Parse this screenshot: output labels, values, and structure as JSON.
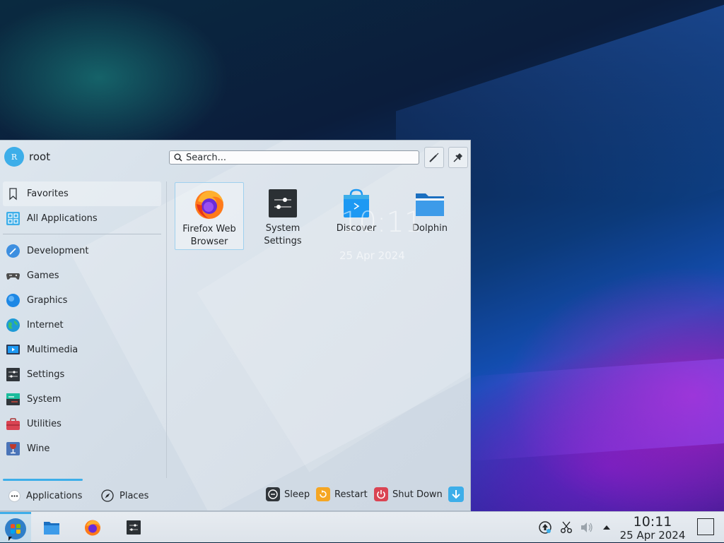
{
  "user": {
    "name": "root",
    "avatar_letter": "R"
  },
  "search": {
    "placeholder": "Search..."
  },
  "sidebar": {
    "top": [
      {
        "label": "Favorites",
        "icon": "bookmark-icon"
      },
      {
        "label": "All Applications",
        "icon": "grid-icon"
      }
    ],
    "categories": [
      {
        "label": "Development",
        "icon": "development-icon",
        "color": "#3d9be9"
      },
      {
        "label": "Games",
        "icon": "gamepad-icon",
        "color": "#4d4d4d"
      },
      {
        "label": "Graphics",
        "icon": "graphics-icon",
        "color": "#1e88e5"
      },
      {
        "label": "Internet",
        "icon": "globe-icon",
        "color": "#1e9ad6"
      },
      {
        "label": "Multimedia",
        "icon": "multimedia-icon",
        "color": "#2b3a55"
      },
      {
        "label": "Settings",
        "icon": "settings-icon",
        "color": "#31363b"
      },
      {
        "label": "System",
        "icon": "system-icon",
        "color": "#31363b"
      },
      {
        "label": "Utilities",
        "icon": "toolbox-icon",
        "color": "#da4453"
      },
      {
        "label": "Wine",
        "icon": "wine-icon",
        "color": "#c0392b"
      }
    ]
  },
  "apps": [
    {
      "label_line1": "Firefox Web",
      "label_line2": "Browser",
      "icon": "firefox-icon"
    },
    {
      "label_line1": "System",
      "label_line2": "Settings",
      "icon": "system-settings-icon"
    },
    {
      "label_line1": "Discover",
      "label_line2": "",
      "icon": "discover-icon"
    },
    {
      "label_line1": "Dolphin",
      "label_line2": "",
      "icon": "folder-icon"
    }
  ],
  "desktop_clock": {
    "time": "10:11",
    "date": "25 Apr 2024"
  },
  "bottom_tabs": {
    "applications": "Applications",
    "places": "Places"
  },
  "power": {
    "sleep": "Sleep",
    "restart": "Restart",
    "shutdown": "Shut Down"
  },
  "taskbar": {
    "time": "10:11",
    "date": "25 Apr 2024"
  },
  "colors": {
    "accent": "#3daee9",
    "text": "#232629",
    "shutdown": "#da4453",
    "restart": "#f5a623"
  }
}
